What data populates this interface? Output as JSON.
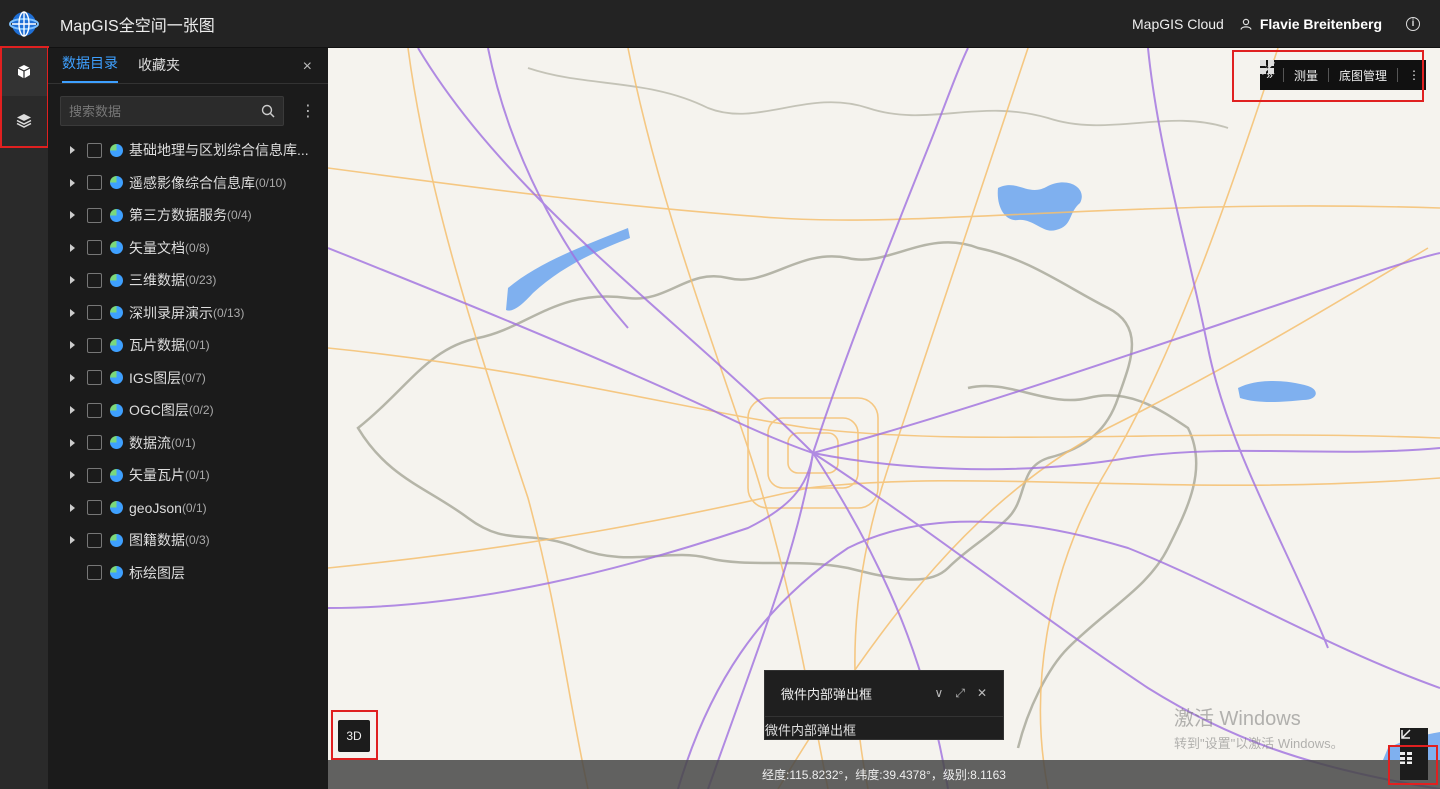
{
  "header": {
    "app_title": "MapGIS全空间一张图",
    "cloud_link": "MapGIS Cloud",
    "user_name": "Flavie Breitenberg",
    "info_icon": "i"
  },
  "rail": {
    "items": [
      "cube-icon",
      "layers-icon"
    ]
  },
  "panel": {
    "tabs": [
      {
        "label": "数据目录",
        "active": true
      },
      {
        "label": "收藏夹",
        "active": false
      }
    ],
    "close_glyph": "×",
    "search_placeholder": "搜索数据",
    "more_glyph": "⋮",
    "tree": [
      {
        "label": "基础地理与区划综合信息库...",
        "count": "",
        "expandable": true
      },
      {
        "label": "遥感影像综合信息库",
        "count": "(0/10)",
        "expandable": true
      },
      {
        "label": "第三方数据服务",
        "count": "(0/4)",
        "expandable": true
      },
      {
        "label": "矢量文档",
        "count": "(0/8)",
        "expandable": true
      },
      {
        "label": "三维数据",
        "count": "(0/23)",
        "expandable": true
      },
      {
        "label": "深圳录屏演示",
        "count": "(0/13)",
        "expandable": true
      },
      {
        "label": "瓦片数据",
        "count": "(0/1)",
        "expandable": true
      },
      {
        "label": "IGS图层",
        "count": "(0/7)",
        "expandable": true
      },
      {
        "label": "OGC图层",
        "count": "(0/2)",
        "expandable": true
      },
      {
        "label": "数据流",
        "count": "(0/1)",
        "expandable": true
      },
      {
        "label": "矢量瓦片",
        "count": "(0/1)",
        "expandable": true
      },
      {
        "label": "geoJson",
        "count": "(0/1)",
        "expandable": true
      },
      {
        "label": "图籍数据",
        "count": "(0/3)",
        "expandable": true
      },
      {
        "label": "标绘图层",
        "count": "",
        "expandable": false
      }
    ]
  },
  "map_toolbar": {
    "expand_glyph": "»",
    "measure_label": "测量",
    "basemap_label": "底图管理",
    "more_glyph": "⋮"
  },
  "widget": {
    "title": "微件内部弹出框",
    "body": "微件内部弹出框",
    "collapse_glyph": "∨",
    "fullscreen_glyph": "⤢",
    "close_glyph": "✕"
  },
  "btn_3d": "3D",
  "watermark": {
    "line1": "激活 Windows",
    "line2": "转到\"设置\"以激活 Windows。"
  },
  "status": {
    "coords": "经度:115.8232°，纬度:39.4378°，级别:8.1163"
  },
  "colors": {
    "accent": "#3ea0ff",
    "highlight_box": "#e02020",
    "map_bg": "#f5f3ee",
    "road_major": "#a070e0",
    "road_minor": "#f5c070",
    "water": "#7fb0ef",
    "boundary": "#8a8a80"
  }
}
